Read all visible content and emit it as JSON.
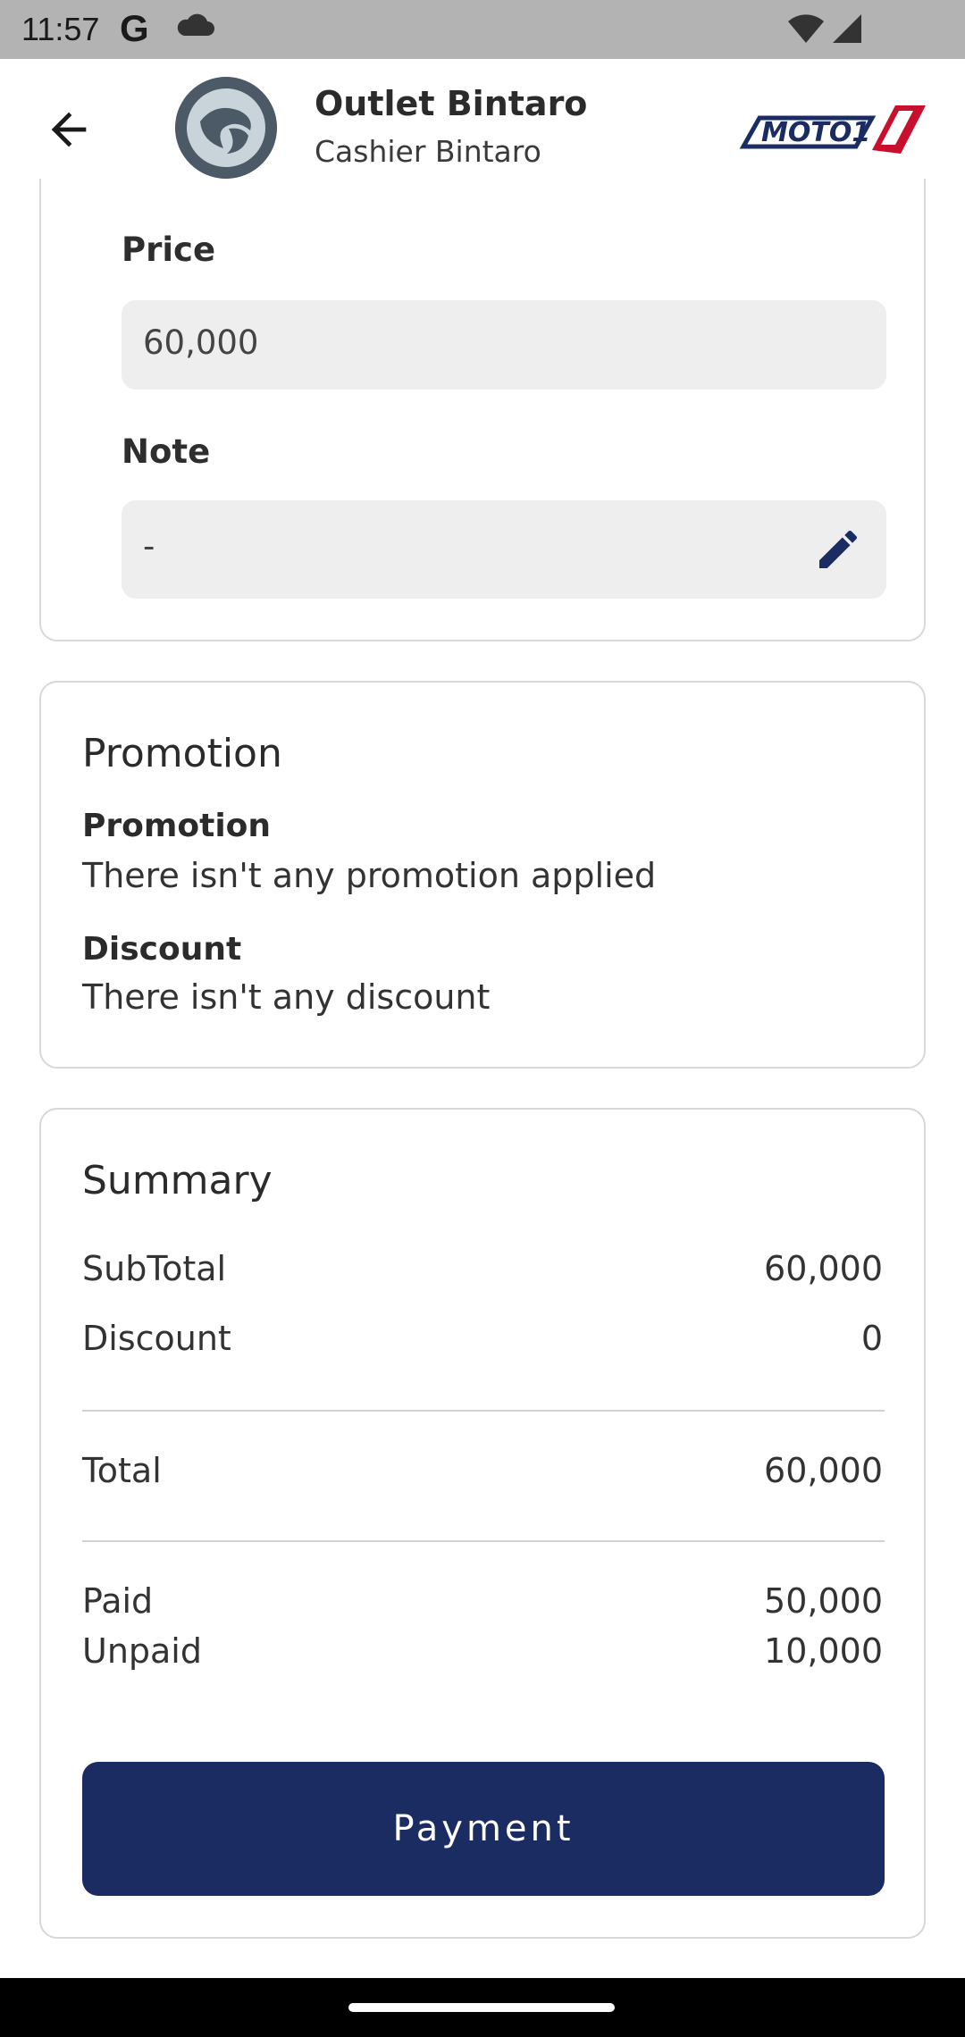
{
  "status_bar": {
    "time": "11:57",
    "g_label": "G"
  },
  "header": {
    "title": "Outlet Bintaro",
    "subtitle": "Cashier Bintaro",
    "brand": "MOTO1",
    "accent_color": "#1b2c63"
  },
  "item_card": {
    "price_label": "Price",
    "price_value": "60,000",
    "note_label": "Note",
    "note_value": "-"
  },
  "promotion_card": {
    "title": "Promotion",
    "promotion_label": "Promotion",
    "promotion_text": "There isn't any promotion applied",
    "discount_label": "Discount",
    "discount_text": "There isn't any discount"
  },
  "summary_card": {
    "title": "Summary",
    "subtotal_label": "SubTotal",
    "subtotal_value": "60,000",
    "discount_label": "Discount",
    "discount_value": "0",
    "total_label": "Total",
    "total_value": "60,000",
    "paid_label": "Paid",
    "paid_value": "50,000",
    "unpaid_label": "Unpaid",
    "unpaid_value": "10,000",
    "payment_button": "Payment"
  },
  "icons": {
    "back": "arrow-left-icon",
    "edit": "pencil-icon",
    "cloud": "cloud-icon",
    "wifi": "wifi-icon",
    "signal": "signal-icon"
  }
}
